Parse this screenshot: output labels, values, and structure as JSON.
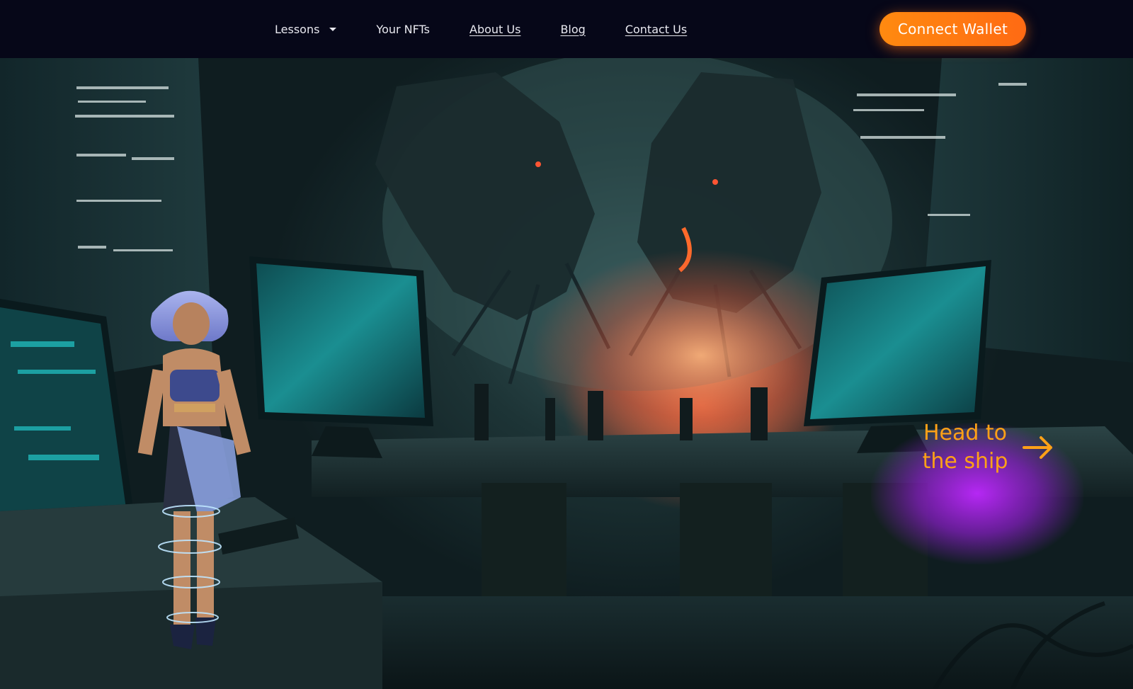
{
  "nav": {
    "lessons_label": "Lessons",
    "nfts_label": "Your NFTs",
    "about_label": "About Us",
    "blog_label": "Blog",
    "contact_label": "Contact Us"
  },
  "wallet": {
    "button_label": "Connect Wallet"
  },
  "cta": {
    "line1": "Head to",
    "line2": "the ship"
  },
  "colors": {
    "navbar_bg": "#060718",
    "accent_orange": "#ff7a12",
    "cta_text": "#ffa117",
    "cta_glow": "#be28ff"
  },
  "icons": {
    "lessons_caret": "caret-down-icon",
    "cta_arrow": "arrow-right-icon"
  }
}
